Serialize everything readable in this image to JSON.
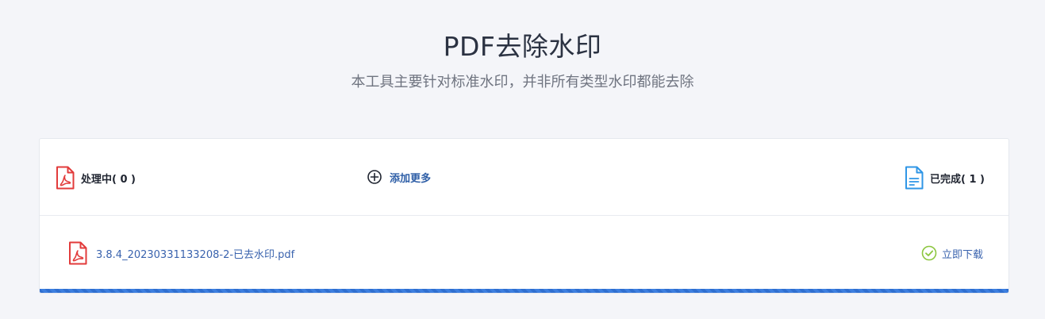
{
  "header": {
    "title": "PDF去除水印",
    "subtitle": "本工具主要针对标准水印，并非所有类型水印都能去除"
  },
  "panel": {
    "processing_label": "处理中( 0 )",
    "add_more_label": "添加更多",
    "completed_label": "已完成( 1 )"
  },
  "files": [
    {
      "name": "3.8.4_20230331133208-2-已去水印.pdf",
      "status_icon": "check-circle-icon",
      "action_label": "立即下载"
    }
  ],
  "progress": {
    "fraction": 1.0
  },
  "colors": {
    "background": "#f4f5f9",
    "pdf_red": "#e23b3b",
    "doc_blue": "#2f96e6",
    "link_blue": "#3a63ae",
    "success_green": "#8cc63f",
    "progress_blue": "#2f6fd0"
  }
}
